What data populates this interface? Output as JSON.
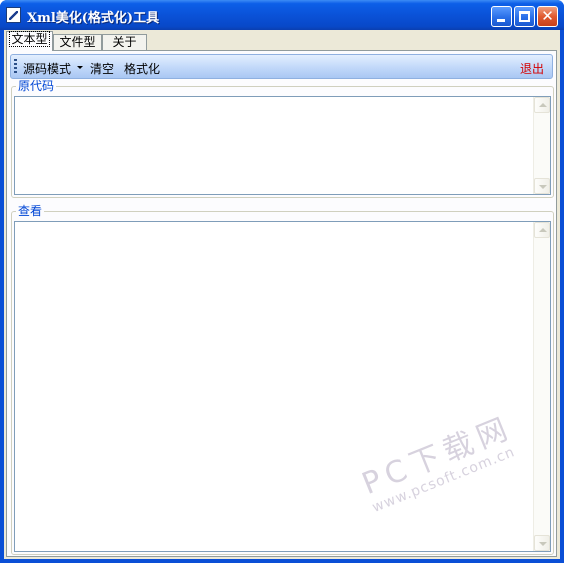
{
  "window": {
    "title": "Xml美化(格式化)工具",
    "minimize_glyph": "",
    "maximize_glyph": "",
    "close_glyph": "✕"
  },
  "tabs": [
    {
      "label": "文本型",
      "active": true
    },
    {
      "label": "文件型",
      "active": false
    },
    {
      "label": "关于",
      "active": false
    }
  ],
  "toolbar": {
    "mode_label": "源码模式",
    "clear_label": "清空",
    "format_label": "格式化",
    "exit_label": "退出",
    "exit_color": "#d40000"
  },
  "source_group": {
    "title": "原代码"
  },
  "view_group": {
    "title": "查看"
  },
  "watermark": {
    "main": "PC下载网",
    "url": "www.pcsoft.com.cn"
  },
  "colors": {
    "titlebar": "#0a52d8",
    "client_bg": "#ece9d8",
    "group_title": "#0046d5"
  }
}
